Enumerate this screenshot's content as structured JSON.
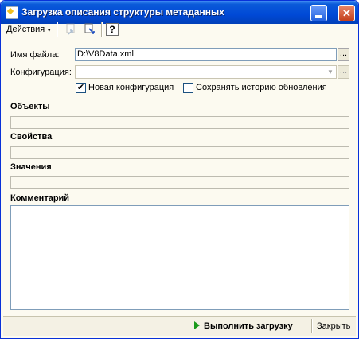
{
  "window": {
    "title": "Загрузка описания структуры метаданных",
    "icon": "wand-icon"
  },
  "toolbar": {
    "actions_label": "Действия",
    "help_label": "?"
  },
  "form": {
    "file_label": "Имя файла:",
    "file_value": "D:\\V8Data.xml",
    "config_label": "Конфигурация:",
    "config_value": "",
    "new_config_label": "Новая конфигурация",
    "new_config_checked": true,
    "save_history_label": "Сохранять историю обновления",
    "save_history_checked": false
  },
  "sections": {
    "objects": "Объекты",
    "properties": "Свойства",
    "values": "Значения",
    "comment": "Комментарий"
  },
  "footer": {
    "run_label": "Выполнить загрузку",
    "close_label": "Закрыть"
  },
  "colors": {
    "titlebar": "#0049d6",
    "run_icon": "#1a9a1a"
  }
}
